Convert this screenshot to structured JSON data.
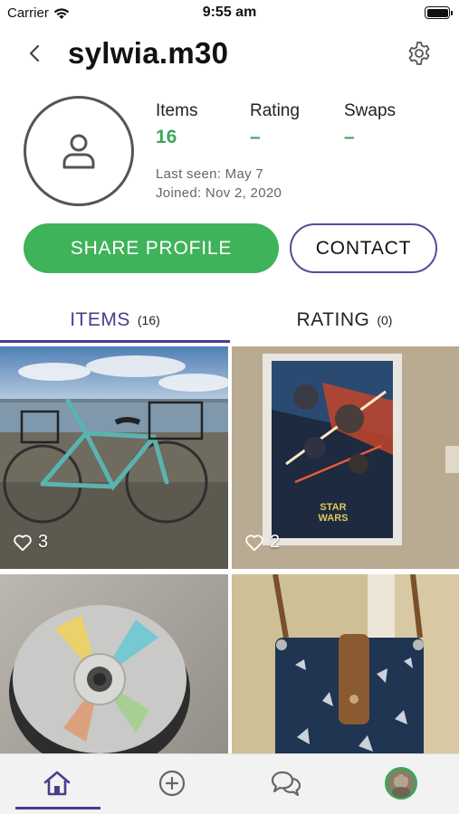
{
  "status_bar": {
    "carrier": "Carrier",
    "time": "9:55 am"
  },
  "header": {
    "username": "sylwia.m30"
  },
  "stats": [
    {
      "label": "Items",
      "value": "16"
    },
    {
      "label": "Rating",
      "value": "–"
    },
    {
      "label": "Swaps",
      "value": "–"
    }
  ],
  "meta": {
    "last_seen": "Last seen: May 7",
    "joined": "Joined: Nov 2, 2020"
  },
  "buttons": {
    "share": "SHARE PROFILE",
    "contact": "CONTACT"
  },
  "tabs": [
    {
      "label": "ITEMS",
      "count": "(16)"
    },
    {
      "label": "RATING",
      "count": "(0)"
    }
  ],
  "items": [
    {
      "photo": "bicycle",
      "likes": "3"
    },
    {
      "photo": "star-wars-poster",
      "likes": "2"
    },
    {
      "photo": "cd-spindle"
    },
    {
      "photo": "shoulder-bag"
    }
  ],
  "icons": {
    "back": "chevron-left-icon",
    "settings": "gear-icon",
    "avatar": "user-icon",
    "heart": "heart-outline-icon",
    "home": "home-icon",
    "add": "plus-circle-icon",
    "chat": "chat-bubbles-icon",
    "profile": "profile-photo-icon"
  },
  "colors": {
    "accent": "#4b3c8c",
    "green": "#3fb35a",
    "stat_green": "#3aa85a"
  }
}
